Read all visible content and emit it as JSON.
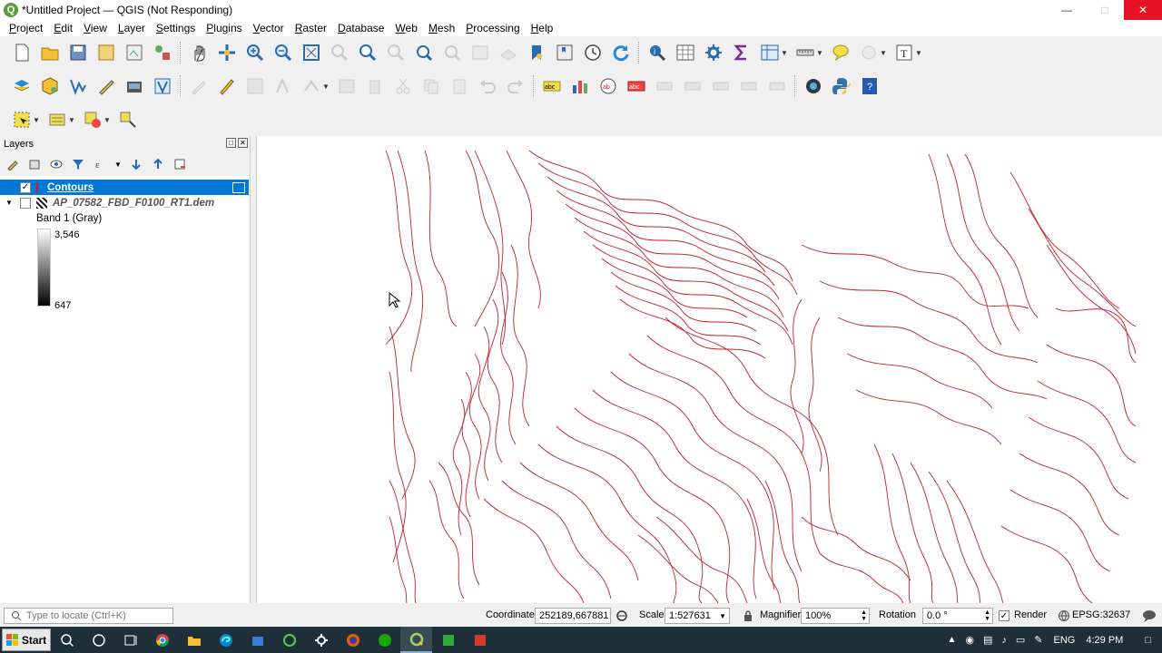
{
  "window": {
    "title": "*Untitled Project — QGIS (Not Responding)"
  },
  "menu": [
    "Project",
    "Edit",
    "View",
    "Layer",
    "Settings",
    "Plugins",
    "Vector",
    "Raster",
    "Database",
    "Web",
    "Mesh",
    "Processing",
    "Help"
  ],
  "layers_panel": {
    "title": "Layers",
    "items": [
      {
        "name": "Contours",
        "checked": true,
        "selected": true
      },
      {
        "name": "AP_07582_FBD_F0100_RT1.dem",
        "checked": false,
        "selected": false
      }
    ],
    "band_label": "Band 1 (Gray)",
    "legend_max": "3,546",
    "legend_min": "647"
  },
  "statusbar": {
    "locate_placeholder": "Type to locate (Ctrl+K)",
    "coordinate_label": "Coordinate",
    "coordinate_value": "252189,667881",
    "scale_label": "Scale",
    "scale_value": "1:527631",
    "magnifier_label": "Magnifier",
    "magnifier_value": "100%",
    "rotation_label": "Rotation",
    "rotation_value": "0.0 °",
    "render_label": "Render",
    "crs": "EPSG:32637"
  },
  "taskbar": {
    "start_label": "Start",
    "language": "ENG",
    "time": "4:29 PM"
  },
  "colors": {
    "contour": "#c0202a",
    "selection": "#0078d7",
    "close_button": "#e81123",
    "taskbar": "#1f2f3a"
  }
}
